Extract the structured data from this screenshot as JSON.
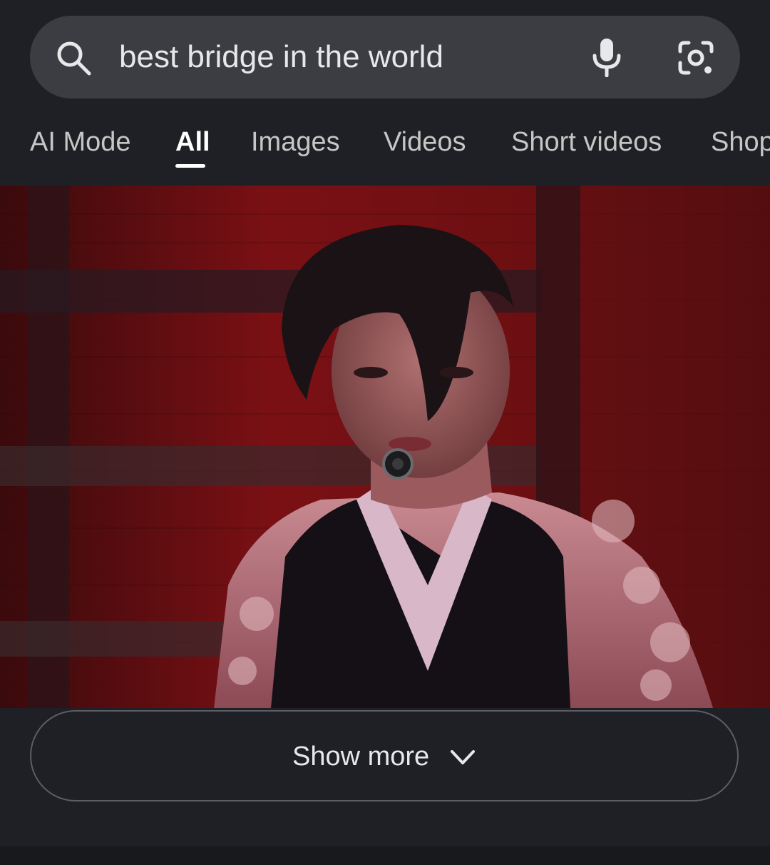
{
  "search": {
    "query": "best bridge in the world",
    "icons": {
      "search": "search-icon",
      "voice": "mic-icon",
      "lens": "camera-lens-icon"
    }
  },
  "tabs": [
    {
      "label": "AI Mode",
      "active": false
    },
    {
      "label": "All",
      "active": true
    },
    {
      "label": "Images",
      "active": false
    },
    {
      "label": "Videos",
      "active": false
    },
    {
      "label": "Short videos",
      "active": false
    },
    {
      "label": "Shop",
      "active": false
    }
  ],
  "media": {
    "kind": "video-thumbnail"
  },
  "show_more": {
    "label": "Show more",
    "icon": "chevron-down-icon"
  },
  "colors": {
    "background": "#1f2025",
    "search_bar": "#3c3d42",
    "text_primary": "#e8e8ea",
    "text_secondary": "#c4c7c5",
    "active_tab": "#ffffff",
    "border": "#5c5e63"
  }
}
